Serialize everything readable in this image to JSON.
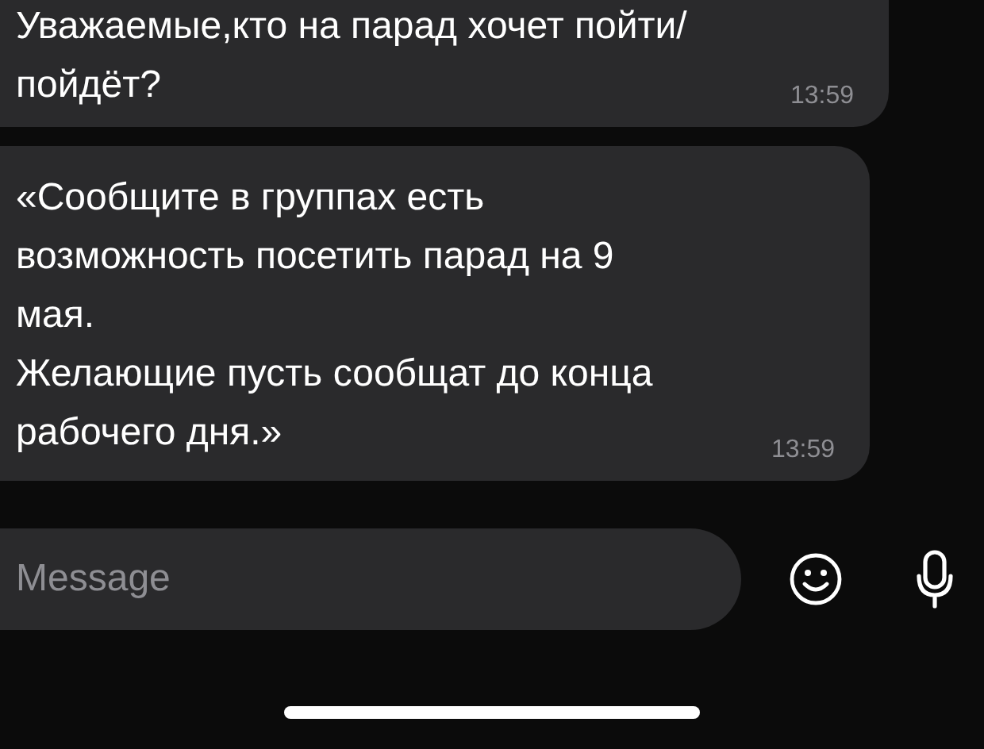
{
  "messages": [
    {
      "text": "Уважаемые,кто на парад хочет пойти/\nпойдёт?",
      "time": "13:59"
    },
    {
      "text": "«Сообщите в группах есть\nвозможность посетить парад на 9\nмая.\nЖелающие пусть сообщат до конца\nрабочего дня.»",
      "time": "13:59"
    }
  ],
  "composer": {
    "placeholder": "Message"
  }
}
